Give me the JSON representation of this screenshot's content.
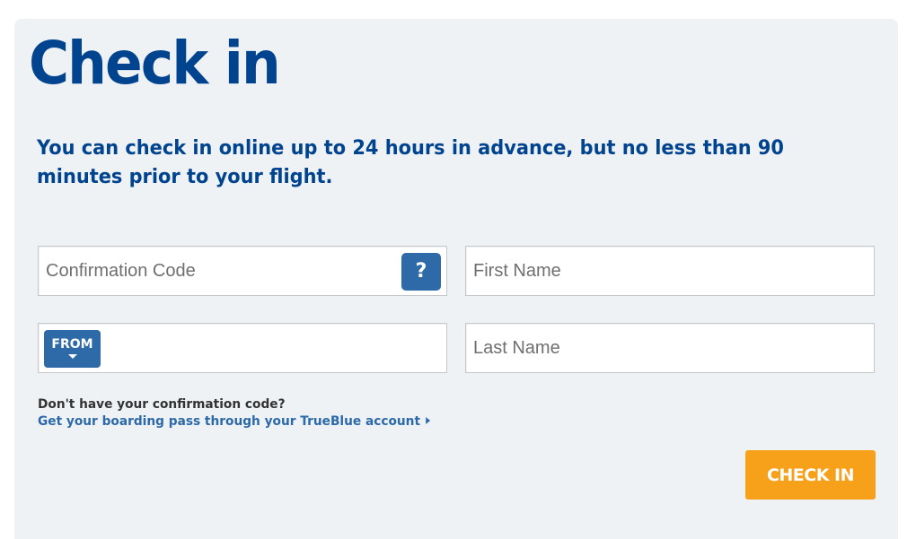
{
  "page": {
    "title": "Check in",
    "intro": "You can check in online up to 24 hours in advance, but no less than 90 minutes prior to your flight."
  },
  "form": {
    "confirmation_placeholder": "Confirmation Code",
    "help_label": "?",
    "first_name_placeholder": "First Name",
    "from_label": "FROM",
    "last_name_placeholder": "Last Name",
    "no_code_text": "Don't have your confirmation code?",
    "trueblue_link": "Get your boarding pass through your TrueBlue account",
    "submit_label": "CHECK IN"
  },
  "colors": {
    "brand_blue": "#00438e",
    "button_blue": "#2f6aa8",
    "accent_orange": "#f7a11a",
    "panel_bg": "#eff2f5"
  },
  "icons": {
    "help": "question-mark-icon",
    "from_dropdown": "caret-down-icon",
    "link_arrow": "caret-right-icon"
  }
}
